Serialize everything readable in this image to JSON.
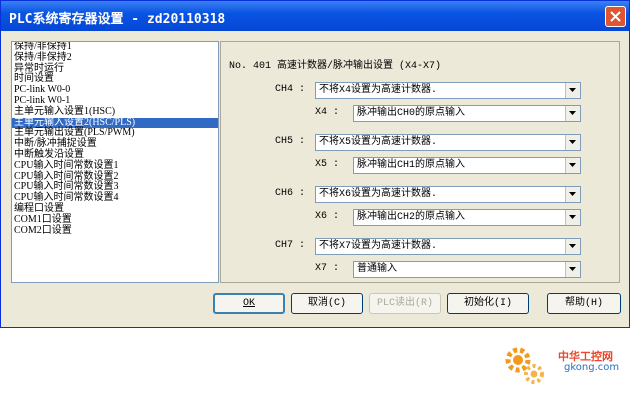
{
  "window": {
    "title": "PLC系统寄存器设置 - zd20110318"
  },
  "list": {
    "items": [
      "保持/非保持1",
      "保持/非保持2",
      "异常时运行",
      "时间设置",
      "PC-link W0-0",
      "PC-link W0-1",
      "主单元输入设置1(HSC)",
      "主单元输入设置2(HSC/PLS)",
      "主单元输出设置(PLS/PWM)",
      "中断/脉冲捕捉设置",
      "中断触发沿设置",
      "CPU输入时间常数设置1",
      "CPU输入时间常数设置2",
      "CPU输入时间常数设置3",
      "CPU输入时间常数设置4",
      "编程口设置",
      "COM1口设置",
      "COM2口设置"
    ],
    "selected_index": 7
  },
  "panel": {
    "heading": "No. 401 高速计数器/脉冲输出设置 (X4-X7)",
    "groups": [
      {
        "ch_label": "CH4 :",
        "ch_value": "不将X4设置为高速计数器.",
        "x_label": "X4 :",
        "x_value": "脉冲输出CH0的原点输入"
      },
      {
        "ch_label": "CH5 :",
        "ch_value": "不将X5设置为高速计数器.",
        "x_label": "X5 :",
        "x_value": "脉冲输出CH1的原点输入"
      },
      {
        "ch_label": "CH6 :",
        "ch_value": "不将X6设置为高速计数器.",
        "x_label": "X6 :",
        "x_value": "脉冲输出CH2的原点输入"
      },
      {
        "ch_label": "CH7 :",
        "ch_value": "不将X7设置为高速计数器.",
        "x_label": "X7 :",
        "x_value": "普通输入"
      }
    ]
  },
  "buttons": {
    "ok": "OK",
    "cancel": "取消(C)",
    "plc_read": "PLC读出(R)",
    "init": "初始化(I)",
    "help": "帮助(H)"
  },
  "watermark": {
    "text_cn": "中华工控网",
    "text_url": "gkong.com"
  },
  "colors": {
    "titlebar": "#0a54e3",
    "selection": "#316ac5",
    "dialog_bg": "#ece9d8",
    "close": "#e0542f"
  }
}
